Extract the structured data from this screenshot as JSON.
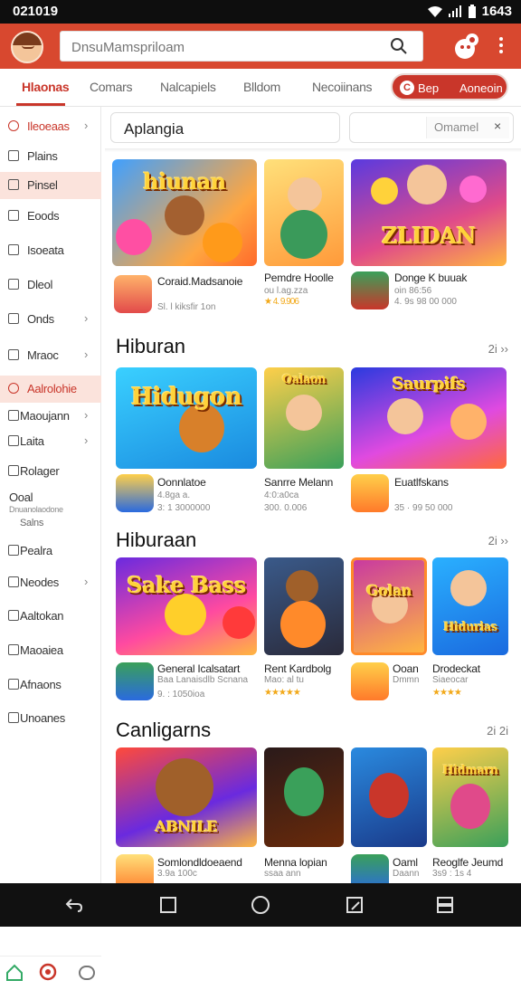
{
  "status": {
    "time": "021019",
    "battery": "1643"
  },
  "search": {
    "placeholder": "DnsuMamspriloam"
  },
  "tabs": [
    {
      "label": "Hlaonas"
    },
    {
      "label": "Comars"
    },
    {
      "label": "Nalcapiels"
    },
    {
      "label": "Blldom"
    },
    {
      "label": "Necoiinans"
    }
  ],
  "tab_pill": {
    "left": "Bep",
    "right": "Aoneoin"
  },
  "sidebar": [
    {
      "label": "Ileoeaas",
      "chevron": "›"
    },
    {
      "label": "Plains",
      "chevron": ""
    },
    {
      "label": "Pinsel",
      "chevron": ""
    },
    {
      "label": "Eoods",
      "chevron": ""
    },
    {
      "label": "Isoeata",
      "chevron": ""
    },
    {
      "label": "Dleol",
      "chevron": ""
    },
    {
      "label": "Onds",
      "chevron": "›"
    },
    {
      "label": "Mraoc",
      "chevron": "›"
    },
    {
      "label": "Aalrolohie",
      "chevron": ""
    },
    {
      "label": "Maoujann",
      "chevron": "›"
    },
    {
      "label": "Laita",
      "chevron": "›"
    },
    {
      "label": "Rolager",
      "chevron": ""
    },
    {
      "label": "Ooal",
      "chevron": ""
    },
    {
      "label": "Dnuanolaodone",
      "chevron": ""
    },
    {
      "label": "Salns",
      "chevron": ""
    },
    {
      "label": "Pealra",
      "chevron": ""
    },
    {
      "label": "Neodes",
      "chevron": "›"
    },
    {
      "label": "Aaltokan",
      "chevron": ""
    },
    {
      "label": "Maoaiea",
      "chevron": ""
    },
    {
      "label": "Afnaons",
      "chevron": ""
    },
    {
      "label": "Unoanes",
      "chevron": ""
    }
  ],
  "filters": {
    "left": "Aplangia",
    "right": "Omamel",
    "clear": "×"
  },
  "sections": [
    {
      "title": "",
      "arrows": "",
      "cards": [
        {
          "art_title": "hiunan",
          "name": "Coraid.Madsanoie",
          "sub": "Sl. l kiksfir 1on"
        },
        {
          "art_title": "",
          "name": "Pemdre Hoolle",
          "sub": "ou l.ag.zza",
          "rating": "★ 4. 9.906"
        },
        {
          "art_title": "ZLIDAN",
          "name": "Donge K buuak",
          "sub": "oin 86:56",
          "sub2": "4. 9s 98 00 000"
        }
      ]
    },
    {
      "title": "Hiburan",
      "arrows": "2i  ››",
      "cards": [
        {
          "art_title": "Hidugon",
          "name": "Oonnlatoe",
          "sub": "4.8ga a.",
          "sub2": "3: 1 3000000"
        },
        {
          "art_title": "Oalaon",
          "name": "Sanrre Melann",
          "sub": "4:0:a0ca",
          "sub2": "300. 0.006"
        },
        {
          "art_title": "Saurpifs",
          "name": "Euatlfskans",
          "sub": "35 · 99 50 000"
        }
      ]
    },
    {
      "title": "Hiburaan",
      "arrows": "2i  ››",
      "cards": [
        {
          "art_title": "Sake Bass",
          "name": "General Icalsatart",
          "sub": "Baa Lanaisdlb Scnana",
          "sub2": "9. : 1050ioa"
        },
        {
          "art_title": "",
          "name": "Rent Kardbolg",
          "sub": "Mao: al tu",
          "rating": "★★★★★"
        },
        {
          "art_title": "Golan",
          "name": "Ooan",
          "sub": "Dmmn"
        },
        {
          "art_title": "Hidurias",
          "name": "Drodeckat",
          "sub": "Siaeocar",
          "rating": "★★★★"
        }
      ]
    },
    {
      "title": "Canligarns",
      "arrows": "2i  2i",
      "cards": [
        {
          "art_title": "ABNILE",
          "name": "Somlondldoeaend",
          "sub": "3.9a 100c"
        },
        {
          "art_title": "",
          "name": "Menna lopian",
          "sub": "ssaa ann"
        },
        {
          "art_title": "",
          "name": "Oaml",
          "sub": "Daann"
        },
        {
          "art_title": "Hidmarn",
          "name": "Reoglfe Jeumd",
          "sub": "3s9 : 1s 4"
        }
      ]
    }
  ],
  "colors": {
    "brand": "#d8482f",
    "accent": "#c9362a"
  }
}
